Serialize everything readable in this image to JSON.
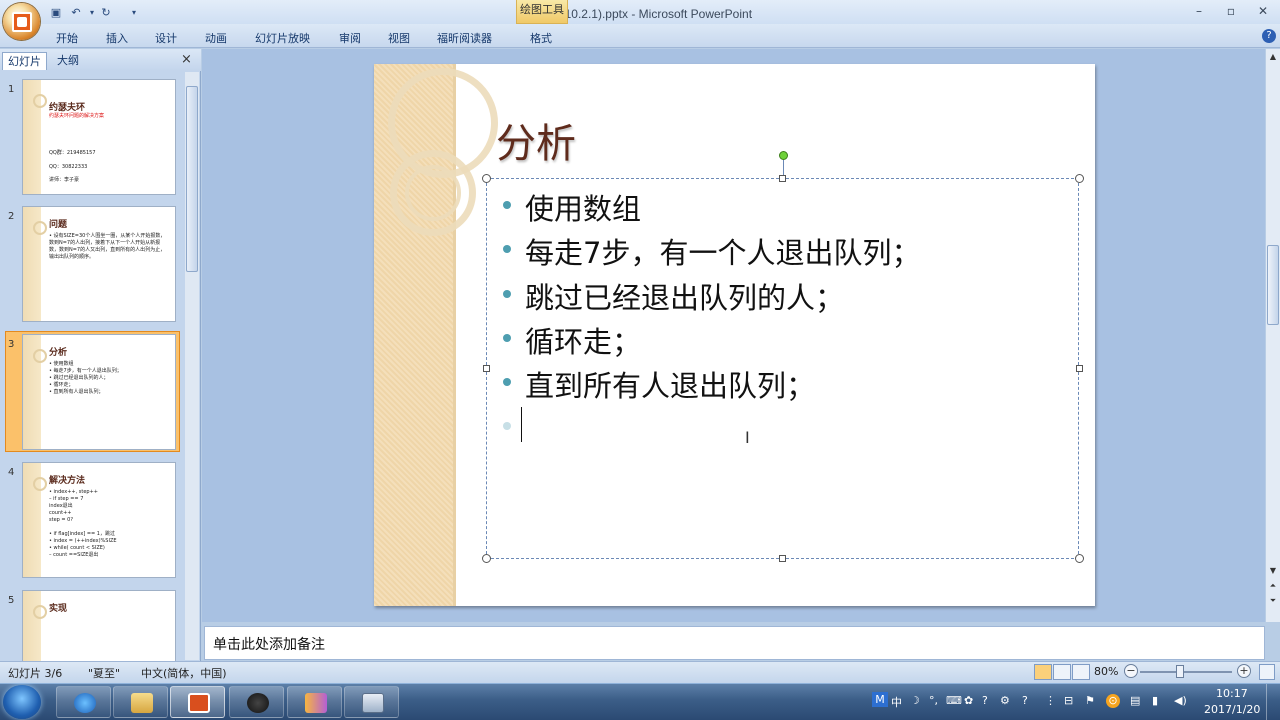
{
  "window": {
    "title": "C语言(10.2.1).pptx - Microsoft PowerPoint",
    "contextual_tab_group": "绘图工具",
    "minimize_icon": "minimize-icon",
    "maximize_icon": "restore-icon",
    "close_icon": "close-icon"
  },
  "ribbon": {
    "tabs": [
      "开始",
      "插入",
      "设计",
      "动画",
      "幻灯片放映",
      "审阅",
      "视图",
      "福昕阅读器",
      "格式"
    ]
  },
  "left_panel": {
    "tabs": [
      "幻灯片",
      "大纲"
    ],
    "close": "×",
    "slides": [
      {
        "num": "1",
        "title": "约瑟夫环",
        "subtitle": "约瑟夫环问题的解决方案",
        "lines": [
          "QQ群：219485157",
          "QQ：30822333",
          "讲师：李子豪"
        ]
      },
      {
        "num": "2",
        "title": "问题",
        "lines": [
          "• 设有SIZE=30个人围坐一圈，从某个人开始报数，数到N=7的人出列，接着下从下一个人开始从新报数，数到N=7的人又出列，直到所有的人出列为止，输出出队列的顺序。"
        ]
      },
      {
        "num": "3",
        "title": "分析",
        "lines": [
          "• 使用数组",
          "• 每走7步，有一个人退出队列；",
          "• 跳过已经退出队列的人；",
          "• 循环走；",
          "• 直到所有人退出队列；"
        ]
      },
      {
        "num": "4",
        "title": "解决方法",
        "lines": [
          "• index++, step++",
          "  – if step == 7",
          "      index退出",
          "      count++",
          "      step = 0?",
          "• if flag[index] == 1，跳过",
          "• index = (++index)%SIZE",
          "• while( count < SIZE)",
          "  – count ==SIZE退出"
        ]
      },
      {
        "num": "5",
        "title": "实现",
        "lines": []
      }
    ]
  },
  "slide": {
    "title": "分析",
    "bullets": [
      "使用数组",
      "每走7步，有一个人退出队列；",
      "跳过已经退出队列的人；",
      "循环走；",
      "直到所有人退出队列；",
      ""
    ]
  },
  "notes": {
    "placeholder": "单击此处添加备注"
  },
  "status_bar": {
    "slide_info": "幻灯片 3/6",
    "theme": "\"夏至\"",
    "language": "中文(简体，中国)",
    "zoom": "80%"
  },
  "taskbar": {
    "apps": [
      "internet-explorer",
      "file-explorer",
      "powerpoint",
      "obs",
      "visual-studio",
      "calculator"
    ],
    "time": "10:17",
    "date": "2017/1/20"
  },
  "colors": {
    "title_brown": "#5f2b1c",
    "bullet_teal": "#4e9eb0",
    "thumb_selected": "#fbc16a"
  }
}
